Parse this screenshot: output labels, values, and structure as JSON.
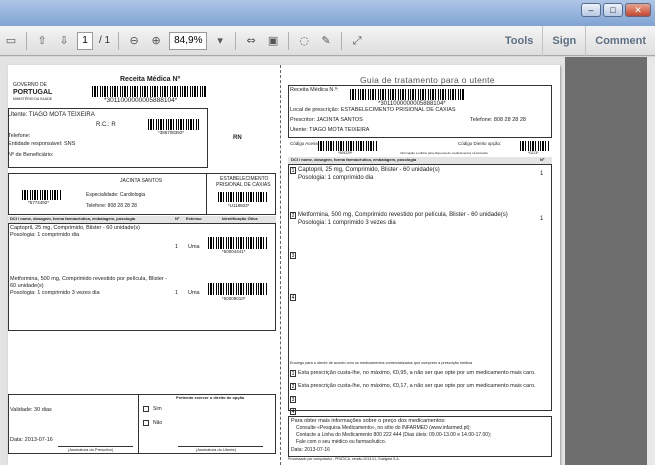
{
  "toolbar": {
    "page_current": "1",
    "page_total": "/ 1",
    "zoom": "84,9%",
    "tools": "Tools",
    "sign": "Sign",
    "comment": "Comment"
  },
  "receita": {
    "title": "Receita Médica Nº",
    "gov1": "GOVERNO DE",
    "gov2": "PORTUGAL",
    "ministry": "MINISTÉRIO DA SAÚDE",
    "barcode_num": "*3011000000005888104*",
    "utente": "Utente: TIAGO MOTA TEIXEIRA",
    "rc": "R.C.: R",
    "code386": "*386708392*",
    "rn": "RN",
    "telefone": "Telefone:",
    "entidade": "Entidade responsável: SNS",
    "beneficiario": "Nº de Beneficiário:",
    "medico": "JACINTA SANTOS",
    "especialidade": "Especialidade: Cardiologia",
    "telefone_med": "Telefone: 808 28 28 28",
    "code5774": "*5774492*",
    "local1": "ESTABELECIMENTO",
    "local2": "PRISIONAL DE CAXIAS",
    "code118": "*U118503*",
    "hdr_dci": "DCI / nome, dosagem, forma farmacêutica, embalagem, posologia",
    "hdr_n": "Nº",
    "hdr_ext": "Extenso",
    "hdr_id": "Identificação Ótica",
    "med1_line1": "Captopril, 25 mg, Comprimido, Blister - 60 unidade(s)",
    "med1_line2": "Posologia: 1 comprimido dia",
    "med1_n": "1",
    "med1_ext": "Uma",
    "med1_code": "*50004441*",
    "med2_line1": "Metformina, 500 mg, Comprimido revestido por película, Blister -",
    "med2_line2": "60 unidade(s)",
    "med2_line3": "Posologia: 1 comprimido 3 vezes dia",
    "med2_n": "1",
    "med2_ext": "Uma",
    "med2_code": "*50009010*",
    "validade": "Validade: 30 dias",
    "data": "Data: 2013-07-16",
    "pretendo": "Pretendo exercer o direito de opção",
    "sim": "Sim",
    "nao": "Não",
    "ass_prescritor": "(Assinatura do Prescritor)",
    "ass_utente": "(Assinatura do Utente)"
  },
  "guia": {
    "title": "Guia de tratamento para o utente",
    "receita_label": "Receita Médica N.º:",
    "barcode_num": "*3011000000005888104*",
    "local": "Local de prescrição: ESTABELECIMENTO PRISIONAL DE CAXIAS",
    "prescritor": "Prescritor: JACINTA SANTOS",
    "telefone": "Telefone: 808 28 28 28",
    "utente": "Utente: TIAGO MOTA TEIXEIRA",
    "codigo_acesso": "Código Acesso:",
    "codigo_opcao": "Código Direito opção:",
    "code1": "*509229*",
    "info_small": "Informação a utilizar para dispensa de medicamentos na farmácia",
    "code2": "*0223*",
    "hdr_dci": "DCI / nome, dosagem, forma farmacêutica, embalagem, posologia",
    "hdr_n": "Nº",
    "med1_line1": "Captopril, 25 mg, Comprimido, Blister - 60 unidade(s)",
    "med1_line2": "Posologia: 1 comprimido dia",
    "med1_n": "1",
    "med2_line1": "Metformina, 500 mg, Comprimido revestido por película, Blister - 60 unidade(s)",
    "med2_line2": "Posologia: 1 comprimido 3 vezes dia",
    "med2_n": "1",
    "encargo": "Encargo para o utente de acordo com os medicamentos comercializados que cumprem a prescrição médica",
    "cost1": "Esta prescrição custa-lhe, no máximo, €0,95, a não ser que opte por um medicamento mais caro.",
    "cost2": "Esta prescrição custa-lhe, no máximo, €0,17, a não ser que opte por um medicamento mais caro.",
    "info_title": "Para obter mais informações sobre o preço dos medicamentos:",
    "info1": "Consulte «Pesquisa Medicamento», no sítio do INFARMED (www.infarmed.pt);",
    "info2": "Contacte a Linha do Medicamento 800 222 444 (Dias úteis: 09.00-13.00 e 14.00-17.00);",
    "info3": "Fale com o seu médico ou farmacêutico.",
    "data": "Data: 2013-07-16",
    "footer": "Processado por computador - PRATICA, versão 2013.01, Guidgest S.A."
  }
}
